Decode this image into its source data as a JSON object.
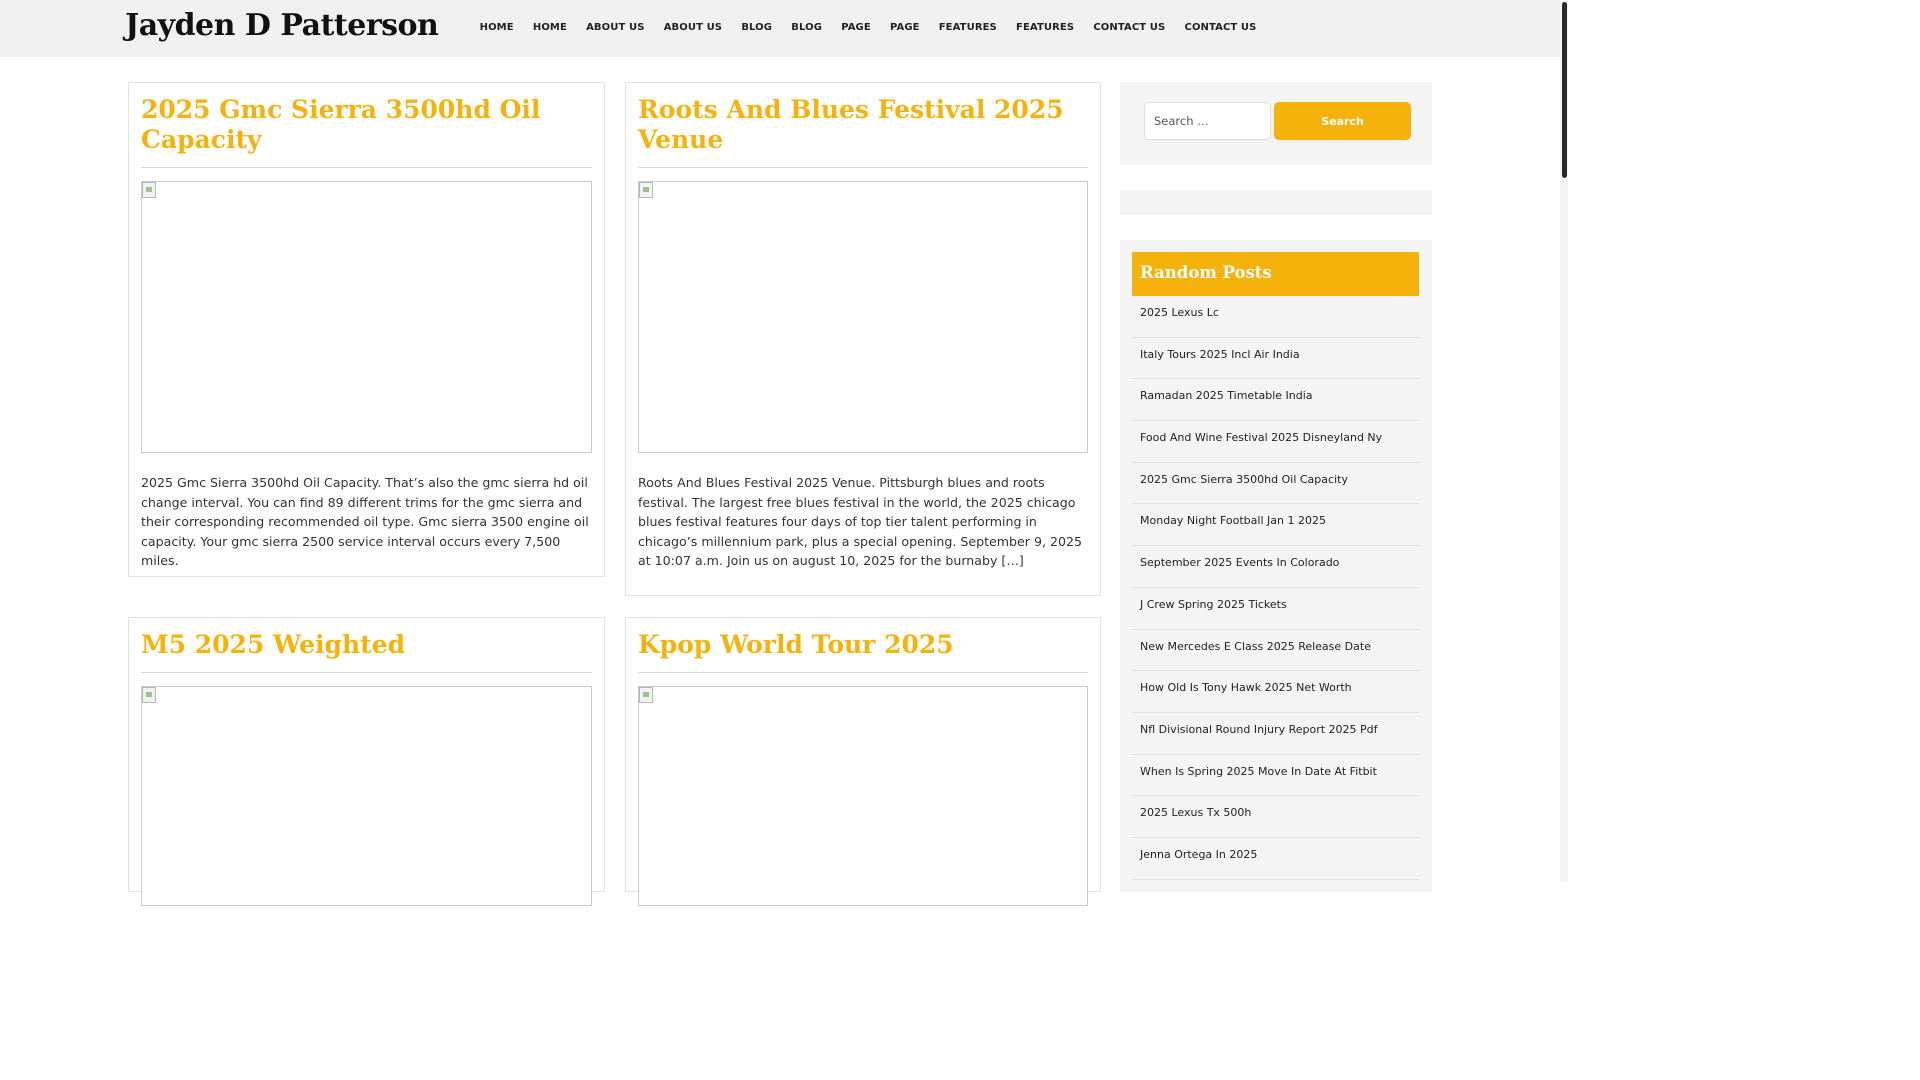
{
  "site": {
    "title": "Jayden D Patterson"
  },
  "nav": {
    "items": [
      {
        "label": "HOME"
      },
      {
        "label": "HOME"
      },
      {
        "label": "ABOUT US"
      },
      {
        "label": "ABOUT US"
      },
      {
        "label": "BLOG"
      },
      {
        "label": "BLOG"
      },
      {
        "label": "PAGE"
      },
      {
        "label": "PAGE"
      },
      {
        "label": "FEATURES"
      },
      {
        "label": "FEATURES"
      },
      {
        "label": "CONTACT US"
      },
      {
        "label": "CONTACT US"
      }
    ]
  },
  "posts": [
    {
      "title": "2025 Gmc Sierra 3500hd Oil Capacity",
      "excerpt": "2025 Gmc Sierra 3500hd Oil Capacity. That’s also the gmc sierra hd oil change interval. You can find 89 different trims for the gmc sierra and their corresponding recommended oil type. Gmc sierra 3500 engine oil capacity. Your gmc sierra 2500 service interval occurs every 7,500 miles."
    },
    {
      "title": "Roots And Blues Festival 2025 Venue",
      "excerpt": "Roots And Blues Festival 2025 Venue. Pittsburgh blues and roots festival. The largest free blues festival in the world, the 2025 chicago blues festival features four days of top tier talent performing in chicago’s millennium park, plus a special opening. September 9, 2025 at 10:07 a.m. Join us on august 10, 2025 for the burnaby […]"
    },
    {
      "title": "M5 2025 Weighted",
      "excerpt": ""
    },
    {
      "title": "Kpop World Tour 2025",
      "excerpt": ""
    }
  ],
  "search": {
    "placeholder": "Search …",
    "button_label": "Search"
  },
  "random_posts": {
    "title": "Random Posts",
    "items": [
      {
        "label": "2025 Lexus Lc"
      },
      {
        "label": "Italy Tours 2025 Incl Air India"
      },
      {
        "label": "Ramadan 2025 Timetable India"
      },
      {
        "label": "Food And Wine Festival 2025 Disneyland Ny"
      },
      {
        "label": "2025 Gmc Sierra 3500hd Oil Capacity"
      },
      {
        "label": "Monday Night Football Jan 1 2025"
      },
      {
        "label": "September 2025 Events In Colorado"
      },
      {
        "label": "J Crew Spring 2025 Tickets"
      },
      {
        "label": "New Mercedes E Class 2025 Release Date"
      },
      {
        "label": "How Old Is Tony Hawk 2025 Net Worth"
      },
      {
        "label": "Nfl Divisional Round Injury Report 2025 Pdf"
      },
      {
        "label": "When Is Spring 2025 Move In Date At Fitbit"
      },
      {
        "label": "2025 Lexus Tx 500h"
      },
      {
        "label": "Jenna Ortega In 2025"
      }
    ]
  },
  "colors": {
    "accent": "#f5b20b",
    "header_bg": "#f0f0f0",
    "widget_bg": "#f4f4f4"
  }
}
